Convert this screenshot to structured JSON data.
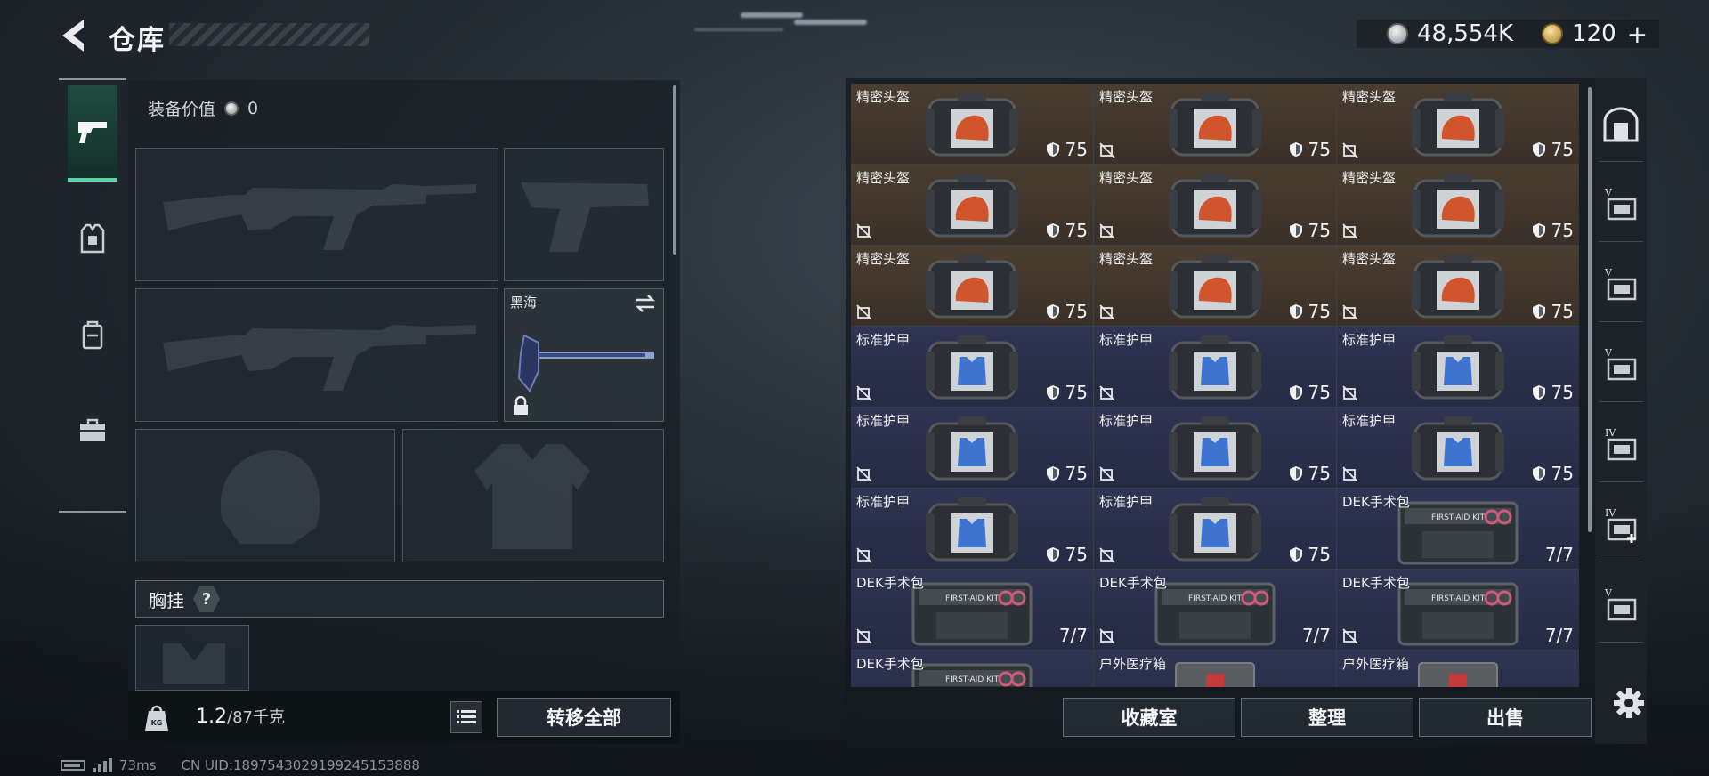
{
  "header": {
    "title": "仓库",
    "currency": [
      {
        "icon": "silver-coin-icon",
        "value": "48,554K"
      },
      {
        "icon": "gold-coin-icon",
        "value": "120"
      }
    ],
    "currency_plus": "+"
  },
  "left_nav": {
    "items": [
      {
        "name": "weapons",
        "icon": "pistol-icon",
        "active": true
      },
      {
        "name": "armor",
        "icon": "vest-icon",
        "active": false
      },
      {
        "name": "backpack",
        "icon": "backpack-icon",
        "active": false
      },
      {
        "name": "supplies",
        "icon": "toolbox-icon",
        "active": false
      }
    ]
  },
  "loadout": {
    "equip_value_label": "装备价值",
    "equip_value": "0",
    "melee_slot_label": "黑海",
    "chest_rig_label": "胸挂",
    "chest_rig_help": "?"
  },
  "bottom_left": {
    "weight_current": "1.2",
    "weight_capacity": "/87千克",
    "transfer_all_label": "转移全部"
  },
  "status": {
    "ping": "73ms",
    "uid": "CN UID:1897543029199245153888"
  },
  "storage": {
    "items": [
      {
        "name": "精密头盔",
        "value": "75",
        "type": "helmet",
        "tint": "brown",
        "no_sell": false
      },
      {
        "name": "精密头盔",
        "value": "75",
        "type": "helmet",
        "tint": "brown",
        "no_sell": true
      },
      {
        "name": "精密头盔",
        "value": "75",
        "type": "helmet",
        "tint": "brown",
        "no_sell": true
      },
      {
        "name": "精密头盔",
        "value": "75",
        "type": "helmet",
        "tint": "brown",
        "no_sell": true
      },
      {
        "name": "精密头盔",
        "value": "75",
        "type": "helmet",
        "tint": "brown",
        "no_sell": true
      },
      {
        "name": "精密头盔",
        "value": "75",
        "type": "helmet",
        "tint": "brown",
        "no_sell": true
      },
      {
        "name": "精密头盔",
        "value": "75",
        "type": "helmet",
        "tint": "brown",
        "no_sell": true
      },
      {
        "name": "精密头盔",
        "value": "75",
        "type": "helmet",
        "tint": "brown",
        "no_sell": true
      },
      {
        "name": "精密头盔",
        "value": "75",
        "type": "helmet",
        "tint": "brown",
        "no_sell": true
      },
      {
        "name": "标准护甲",
        "value": "75",
        "type": "armor",
        "tint": "blue",
        "no_sell": true
      },
      {
        "name": "标准护甲",
        "value": "75",
        "type": "armor",
        "tint": "blue",
        "no_sell": true
      },
      {
        "name": "标准护甲",
        "value": "75",
        "type": "armor",
        "tint": "blue",
        "no_sell": true
      },
      {
        "name": "标准护甲",
        "value": "75",
        "type": "armor",
        "tint": "blue",
        "no_sell": true
      },
      {
        "name": "标准护甲",
        "value": "75",
        "type": "armor",
        "tint": "blue",
        "no_sell": true
      },
      {
        "name": "标准护甲",
        "value": "75",
        "type": "armor",
        "tint": "blue",
        "no_sell": true
      },
      {
        "name": "标准护甲",
        "value": "75",
        "type": "armor",
        "tint": "blue",
        "no_sell": true
      },
      {
        "name": "标准护甲",
        "value": "75",
        "type": "armor",
        "tint": "blue",
        "no_sell": true
      },
      {
        "name": "DEK手术包",
        "value": "7/7",
        "type": "medkit",
        "tint": "blue",
        "no_sell": false
      },
      {
        "name": "DEK手术包",
        "value": "7/7",
        "type": "medkit",
        "tint": "blue",
        "no_sell": true
      },
      {
        "name": "DEK手术包",
        "value": "7/7",
        "type": "medkit",
        "tint": "blue",
        "no_sell": true
      },
      {
        "name": "DEK手术包",
        "value": "7/7",
        "type": "medkit",
        "tint": "blue",
        "no_sell": true
      },
      {
        "name": "DEK手术包",
        "value": "",
        "type": "medkit",
        "tint": "blue",
        "no_sell": false
      },
      {
        "name": "户外医疗箱",
        "value": "",
        "type": "medbox",
        "tint": "blue",
        "no_sell": false
      },
      {
        "name": "户外医疗箱",
        "value": "",
        "type": "medbox",
        "tint": "blue",
        "no_sell": false
      }
    ],
    "medkit_print": "FIRST-AID KIT",
    "buttons": {
      "collection": "收藏室",
      "organize": "整理",
      "sell": "出售"
    },
    "right_rail": [
      {
        "icon": "safe-box-icon",
        "tier": ""
      },
      {
        "icon": "container-v-icon",
        "tier": "V"
      },
      {
        "icon": "container-v-icon",
        "tier": "V"
      },
      {
        "icon": "container-v-icon",
        "tier": "V"
      },
      {
        "icon": "container-iv-icon",
        "tier": "IV"
      },
      {
        "icon": "container-iv-add-icon",
        "tier": "IV"
      },
      {
        "icon": "container-v-icon",
        "tier": "V"
      }
    ]
  },
  "colors": {
    "accent": "#5ed3a8",
    "helmet_cell": "#4a3d31",
    "armor_cell": "#2f3552"
  }
}
